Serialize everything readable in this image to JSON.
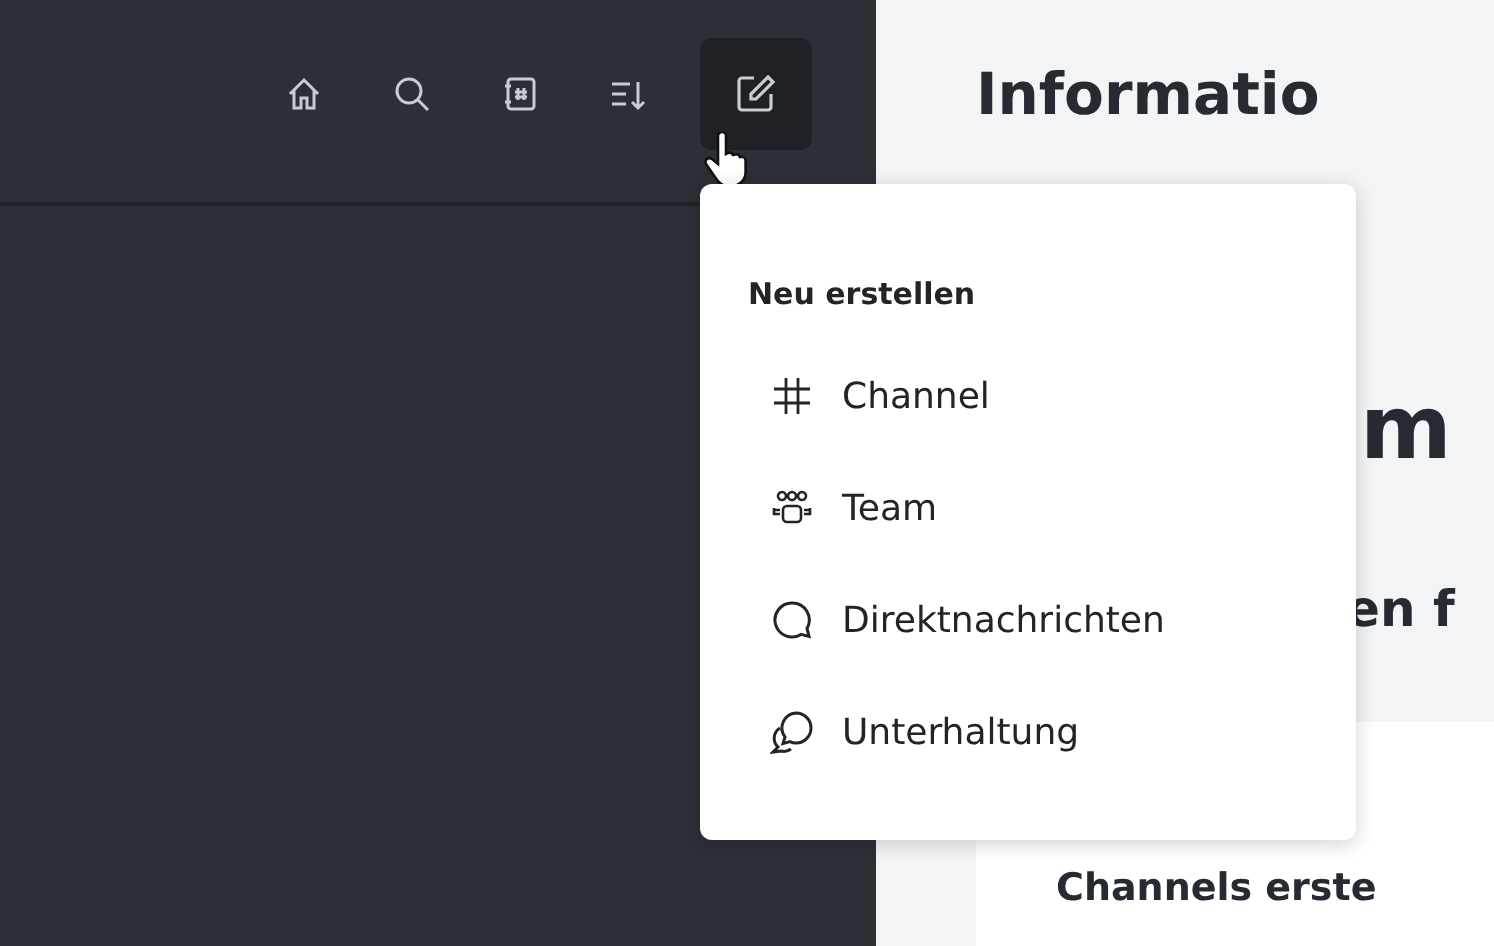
{
  "toolbar": {
    "buttons": [
      {
        "kind": "home",
        "selected": false
      },
      {
        "kind": "search",
        "selected": false
      },
      {
        "kind": "channel-book",
        "selected": false
      },
      {
        "kind": "sort",
        "selected": false
      },
      {
        "kind": "compose",
        "selected": true
      }
    ]
  },
  "content": {
    "title": "Informatio",
    "heading": "m",
    "subheading": "en f",
    "card_title": "Channels erste"
  },
  "menu": {
    "heading": "Neu erstellen",
    "items": [
      {
        "kind": "channel",
        "label": "Channel"
      },
      {
        "kind": "team",
        "label": "Team"
      },
      {
        "kind": "direct",
        "label": "Direktnachrichten"
      },
      {
        "kind": "conversation",
        "label": "Unterhaltung"
      }
    ]
  }
}
